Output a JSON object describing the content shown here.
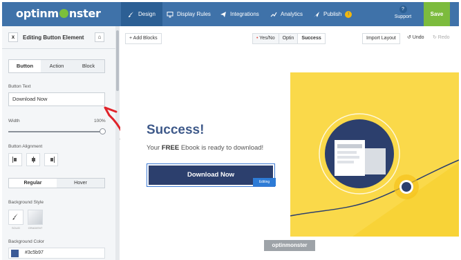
{
  "app": {
    "logo_text_1": "optinm",
    "logo_text_2": "nster"
  },
  "nav": {
    "tabs": [
      {
        "label": "Design",
        "icon": "brush-icon",
        "active": true
      },
      {
        "label": "Display Rules",
        "icon": "monitor-icon"
      },
      {
        "label": "Integrations",
        "icon": "paper-plane-icon"
      },
      {
        "label": "Analytics",
        "icon": "line-chart-icon"
      },
      {
        "label": "Publish",
        "icon": "send-icon"
      }
    ],
    "publish_badge": "!",
    "support_icon": "?",
    "support_label": "Support",
    "save_label": "Save"
  },
  "sidebar": {
    "close_icon": "x",
    "title": "Editing Button Element",
    "home_icon": "⌂",
    "tabs": [
      "Button",
      "Action",
      "Block"
    ],
    "active_tab": "Button",
    "button_text_label": "Button Text",
    "button_text_value": "Download Now",
    "width_label": "Width",
    "width_value": "100%",
    "width_fraction": 1.0,
    "alignment_label": "Button Alignment",
    "state_tabs": [
      "Regular",
      "Hover"
    ],
    "active_state": "Regular",
    "background_style_label": "Background Style",
    "style_options": [
      "SOLID",
      "GRADIENT"
    ],
    "background_color_label": "Background Color",
    "background_color_value": "#3c5b97"
  },
  "toolbar": {
    "add_blocks": "+ Add Blocks",
    "views": [
      "Yes/No",
      "Optin",
      "Success"
    ],
    "active_view": "Success",
    "yes_no_dot": "•",
    "import_layout": "Import Layout",
    "undo": "↺ Undo",
    "redo": "↻ Redo"
  },
  "canvas": {
    "headline": "Success!",
    "subtext_before": "Your ",
    "subtext_bold": "FREE",
    "subtext_after": " Ebook is ready to download!",
    "button_label": "Download Now",
    "editing_tag": "Editing",
    "footer_logo": "optinmonster"
  },
  "colors": {
    "nav_bg": "#3f72a9",
    "nav_active": "#2c5f94",
    "save_green": "#7cbb3d",
    "headline_blue": "#3f5a8a",
    "button_navy": "#2c3f6d",
    "illustration_yellow": "#fad94a",
    "annotation_red": "#e0242b"
  }
}
